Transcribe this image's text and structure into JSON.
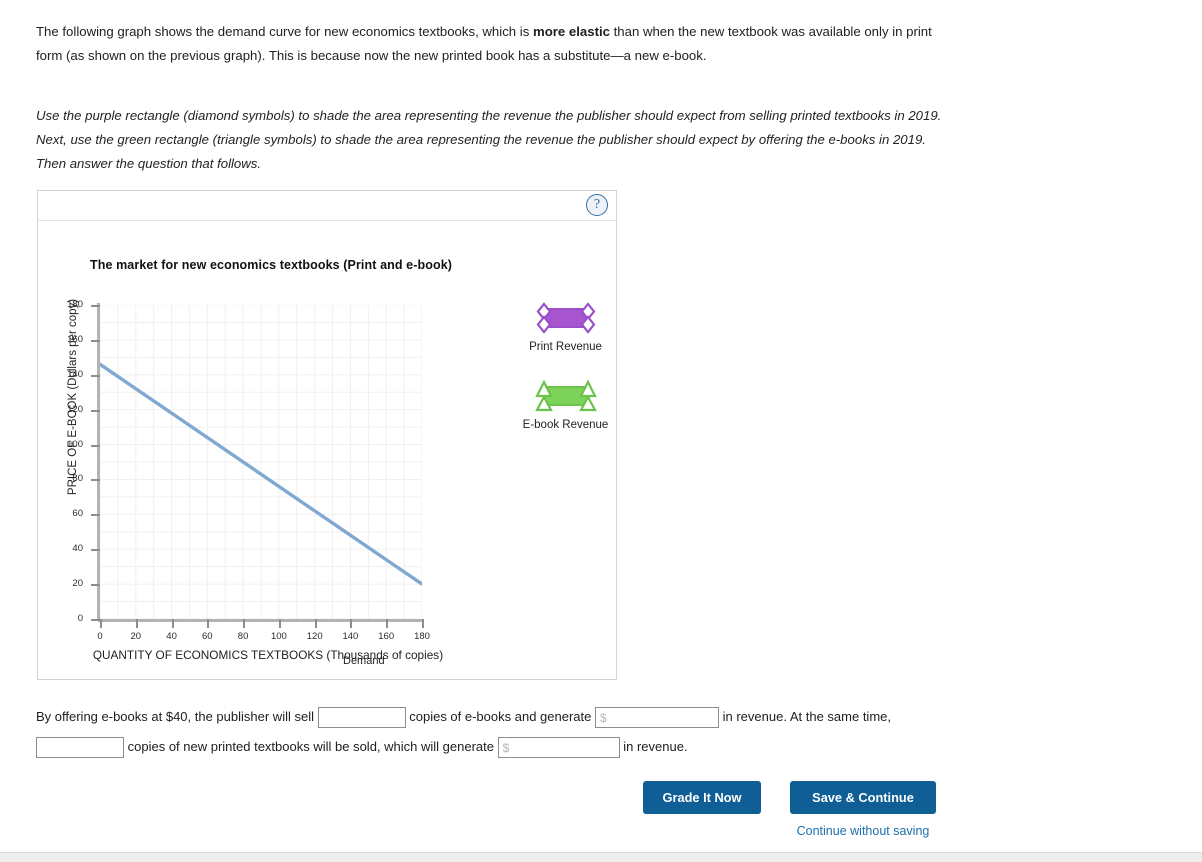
{
  "intro": {
    "text_before_bold": "The following graph shows the demand curve for new economics textbooks, which is ",
    "bold_text": "more elastic",
    "text_after_bold": " than when the new textbook was available only in print form (as shown on the previous graph). This is because now the new printed book has a substitute—a new e-book."
  },
  "instruction": {
    "text": "Use the purple rectangle (diamond symbols) to shade the area representing the revenue the publisher should expect from selling printed textbooks in 2019. Next, use the green rectangle (triangle symbols) to shade the area representing the revenue the publisher should expect by offering the e-books in 2019. Then answer the question that follows."
  },
  "graph_panel": {
    "help_icon": "?",
    "help_glyph": "question-mark"
  },
  "legend": {
    "items": [
      {
        "label": "Print Revenue",
        "color": "#9a4fc8",
        "fill": "#a855d0",
        "handle": "diamond"
      },
      {
        "label": "E-book Revenue",
        "color": "#6cc24a",
        "fill": "#7dd35a",
        "handle": "triangle"
      }
    ]
  },
  "answer": {
    "line1_part1": "By offering e-books at $40, the publisher will sell",
    "qty_ebooks_value": "",
    "qty_ebooks_placeholder": "",
    "line1_part2": "copies of e-books and generate",
    "rev_ebooks_value": "",
    "rev_ebooks_placeholder": "$",
    "line1_part3": "in revenue. At the same time,",
    "qty_print_value": "",
    "qty_print_placeholder": "",
    "line2_part1": "copies of new printed textbooks will be sold, which will generate",
    "rev_print_value": "",
    "rev_print_placeholder": "$",
    "line2_part2": "in revenue."
  },
  "footer": {
    "grade_label": "Grade It Now",
    "save_label": "Save & Continue",
    "continue_label": "Continue without saving",
    "button_color": "#0f5e95",
    "link_color": "#1f6fab"
  },
  "chart_data": {
    "type": "line",
    "title": "The market for new economics textbooks (Print and e-book)",
    "xlabel": "QUANTITY OF ECONOMICS TEXTBOOKS (Thousands of copies)",
    "ylabel": "PRICE OF E-BOOK (Dollars per copy)",
    "xlim": [
      0,
      180
    ],
    "ylim": [
      0,
      180
    ],
    "xticks": [
      0,
      20,
      40,
      60,
      80,
      100,
      120,
      140,
      160,
      180
    ],
    "yticks": [
      0,
      20,
      40,
      60,
      80,
      100,
      120,
      140,
      160,
      180
    ],
    "grid": true,
    "grid_step": 10,
    "legend_position": "right",
    "series": [
      {
        "name": "Demand",
        "color": "#7fa9d0",
        "annotation": "Demand",
        "x": [
          0,
          180
        ],
        "y": [
          146,
          20
        ]
      }
    ]
  }
}
